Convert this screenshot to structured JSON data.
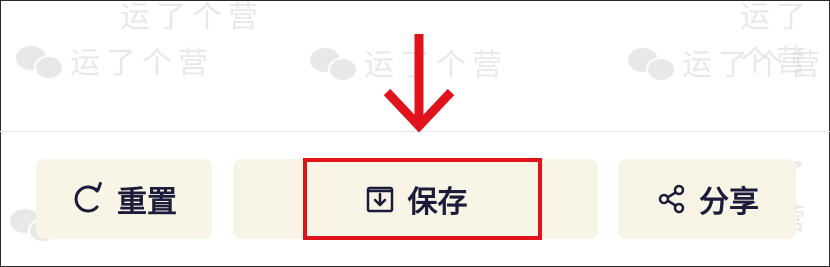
{
  "watermark": {
    "text": "运了个营"
  },
  "actions": {
    "reset": {
      "label": "重置",
      "icon": "refresh-icon"
    },
    "save": {
      "label": "保存",
      "icon": "download-icon"
    },
    "share": {
      "label": "分享",
      "icon": "share-icon"
    }
  },
  "annotation": {
    "color": "#e0131c",
    "target": "save"
  },
  "colors": {
    "button_bg": "#f8f5e7",
    "button_text": "#1c1c3a"
  }
}
